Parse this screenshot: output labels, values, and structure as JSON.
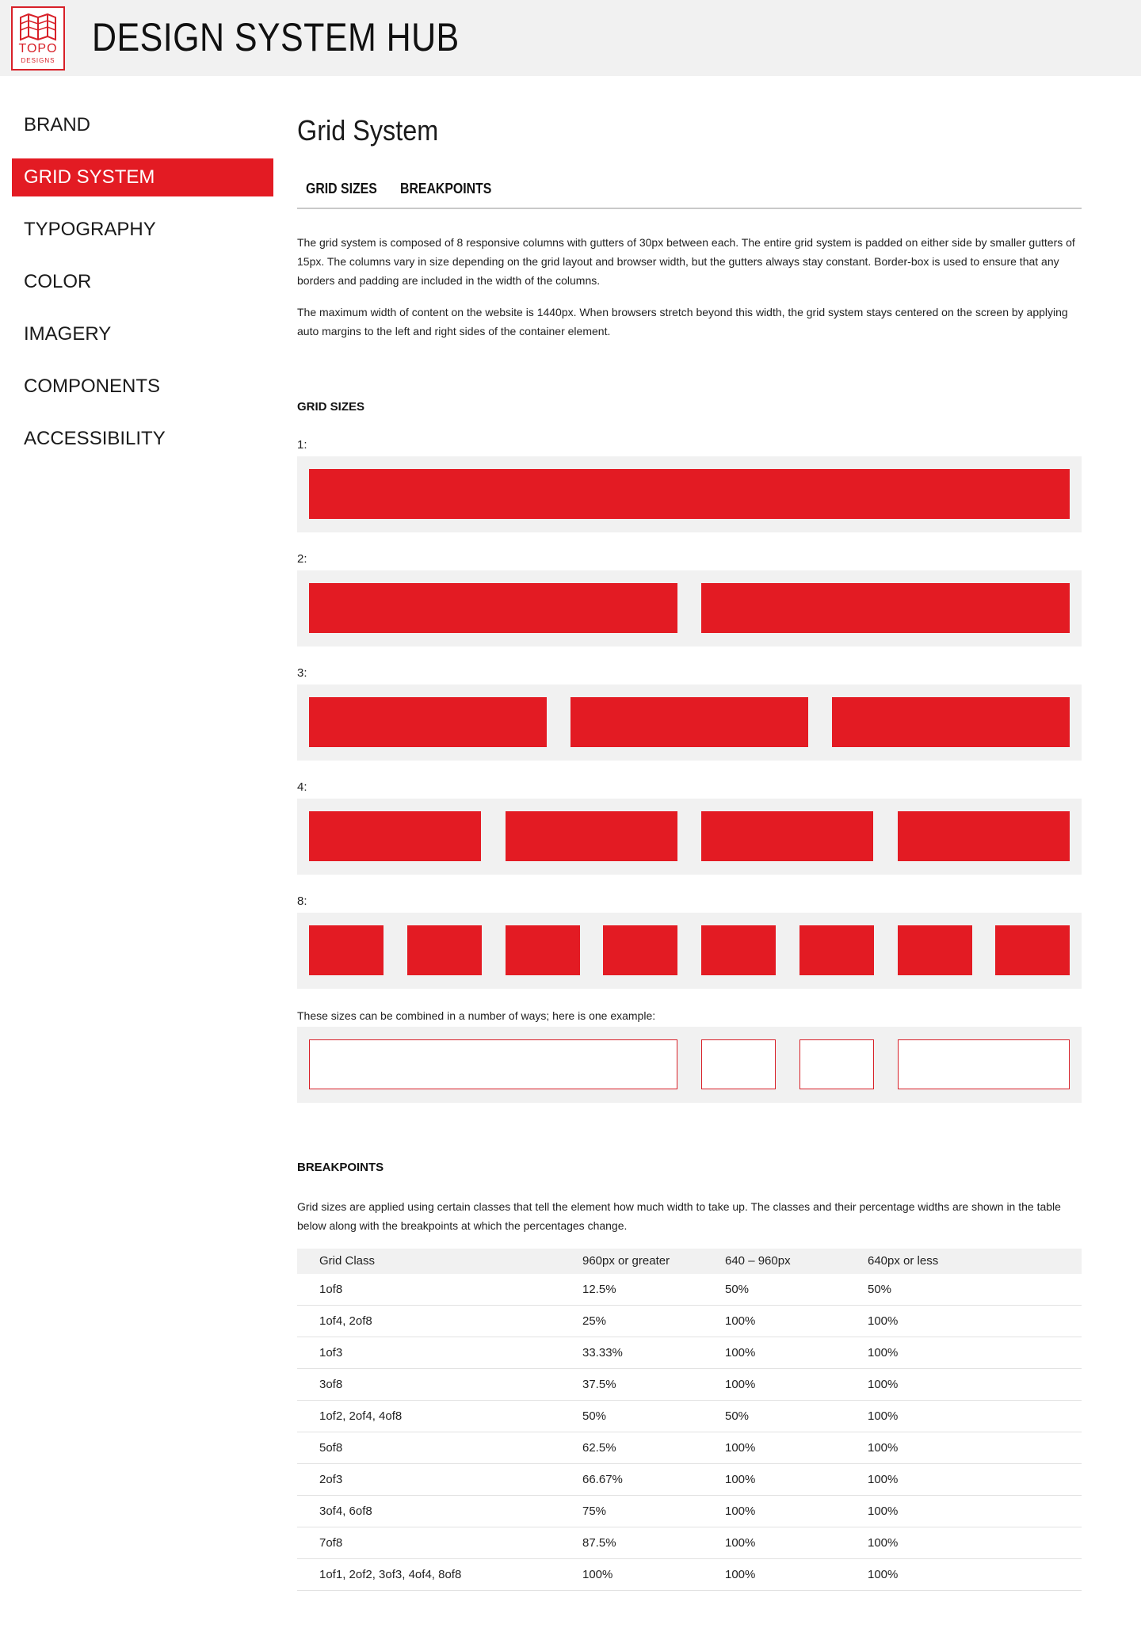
{
  "header": {
    "logo_word": "TOPO",
    "logo_sub": "DESIGNS",
    "title": "DESIGN SYSTEM HUB"
  },
  "sidebar": {
    "items": [
      {
        "label": "BRAND"
      },
      {
        "label": "GRID SYSTEM",
        "active": true
      },
      {
        "label": "TYPOGRAPHY"
      },
      {
        "label": "COLOR"
      },
      {
        "label": "IMAGERY"
      },
      {
        "label": "COMPONENTS"
      },
      {
        "label": "ACCESSIBILITY"
      }
    ]
  },
  "main": {
    "title": "Grid System",
    "tabs": [
      {
        "label": "GRID SIZES"
      },
      {
        "label": "BREAKPOINTS"
      }
    ],
    "intro": [
      "The grid system is composed of 8 responsive columns with gutters of 30px between each. The entire grid system is padded on either side by smaller gutters of 15px. The columns vary in size depending on the grid layout and browser width, but the gutters always stay constant. Border-box is used to ensure that any borders and padding are included in the width of the columns.",
      "The maximum width of content on the website is 1440px. When browsers stretch beyond this width, the grid system stays centered on the screen by applying auto margins to the left and right sides of the container element."
    ],
    "grid_sizes": {
      "heading": "GRID SIZES",
      "rows": [
        {
          "label": "1:",
          "columns": 1
        },
        {
          "label": "2:",
          "columns": 2
        },
        {
          "label": "3:",
          "columns": 3
        },
        {
          "label": "4:",
          "columns": 4
        },
        {
          "label": "8:",
          "columns": 8
        }
      ],
      "combo_caption": "These sizes can be combined in a number of ways; here is one example:",
      "combo_spans_of_8": [
        4,
        1,
        1,
        2
      ]
    },
    "breakpoints": {
      "heading": "BREAKPOINTS",
      "description": "Grid sizes are applied using certain classes that tell the element how much width to take up. The classes and their percentage widths are shown in the table below along with the breakpoints at which the percentages change.",
      "columns": [
        "Grid Class",
        "960px or greater",
        "640 – 960px",
        "640px or less"
      ],
      "rows": [
        [
          "1of8",
          "12.5%",
          "50%",
          "50%"
        ],
        [
          "1of4, 2of8",
          "25%",
          "100%",
          "100%"
        ],
        [
          "1of3",
          "33.33%",
          "100%",
          "100%"
        ],
        [
          "3of8",
          "37.5%",
          "100%",
          "100%"
        ],
        [
          "1of2, 2of4, 4of8",
          "50%",
          "50%",
          "100%"
        ],
        [
          "5of8",
          "62.5%",
          "100%",
          "100%"
        ],
        [
          "2of3",
          "66.67%",
          "100%",
          "100%"
        ],
        [
          "3of4, 6of8",
          "75%",
          "100%",
          "100%"
        ],
        [
          "7of8",
          "87.5%",
          "100%",
          "100%"
        ],
        [
          "1of1, 2of2, 3of3, 4of4, 8of8",
          "100%",
          "100%",
          "100%"
        ]
      ]
    }
  },
  "colors": {
    "accent": "#e31b23",
    "header_bg": "#f1f1f1",
    "row_bg": "#f1f1f1"
  }
}
